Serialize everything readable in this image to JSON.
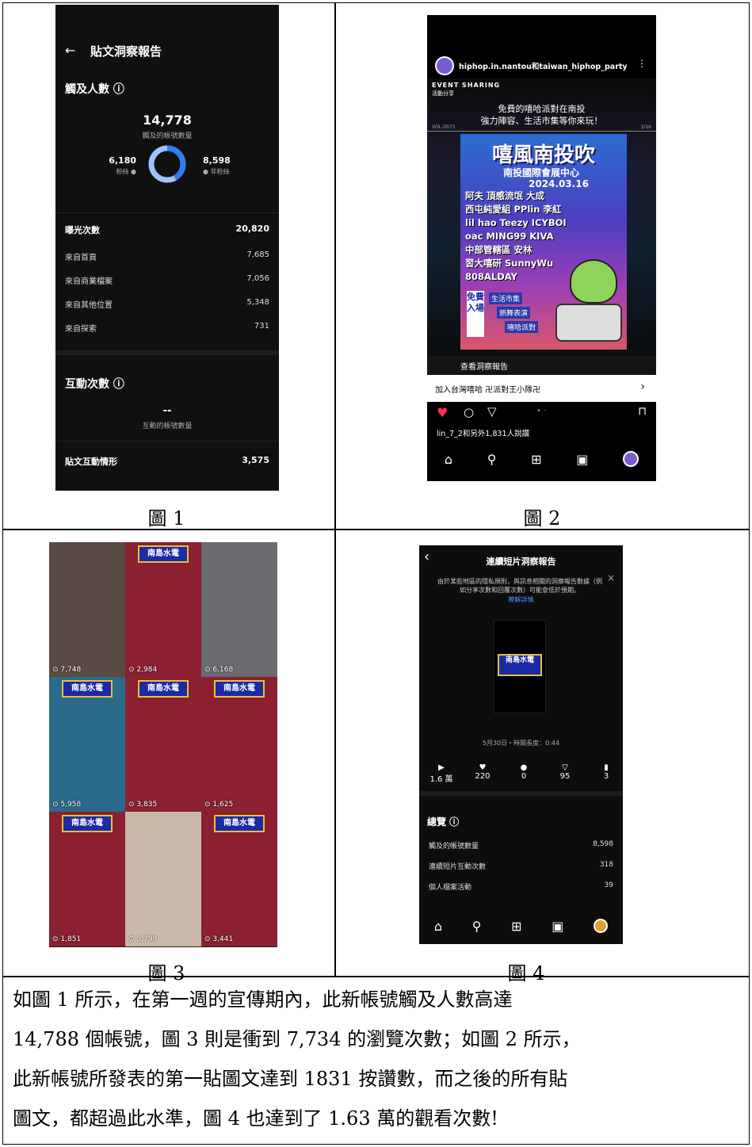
{
  "panel1": {
    "title": "貼文洞察報告",
    "back": "←",
    "reach_heading": "觸及人數 ⓘ",
    "reach_total": "14,778",
    "reach_caption": "觸及的帳號數量",
    "followers_value": "6,180",
    "followers_label": "粉絲 ●",
    "nonfollowers_value": "8,598",
    "nonfollowers_label": "● 非粉絲",
    "followers_fraction": 0.418,
    "impressions_label": "曝光次數",
    "impressions_value": "20,820",
    "rows": [
      {
        "label": "來自首頁",
        "value": "7,685"
      },
      {
        "label": "來自商業檔案",
        "value": "7,056"
      },
      {
        "label": "來自其他位置",
        "value": "5,348"
      },
      {
        "label": "來自探索",
        "value": "731"
      }
    ],
    "interactions_heading": "互動次數 ⓘ",
    "interactions_value": "--",
    "interactions_caption": "互動的帳號數量",
    "post_interactions_label": "貼文互動情形",
    "post_interactions_value": "3,575"
  },
  "panel2": {
    "account": "hiphop.in.nantou和taiwan_hiphop_party",
    "menu": "⋮",
    "event_sharing": "EVENT SHARING",
    "event_sub": "活動分享",
    "tagline1": "免費的嘻哈派對在南投",
    "tagline2": "強力陣容、生活市集等你來玩！",
    "vol": "VOL.0073",
    "page": "3/16",
    "poster_title": "嘻風南投吹",
    "venue": "南投國際會展中心",
    "date": "2024.03.16",
    "lineup": [
      "阿夫 頂感流氓 大成",
      "西屯純愛組 PPlin 李紅",
      "lil hao Teezy ICYBOI",
      "oac MING99 KIVA",
      "中部管轄區 安林",
      "習大嘻研 SunnyWu",
      "808ALDAY"
    ],
    "free_entry": "免費入場",
    "tags": [
      "生活市集",
      "熱舞表演",
      "嘻哈派對"
    ],
    "insights_link": "查看洞察報告",
    "join_text": "加入台灣嘻哈 卍派對王小隊卍",
    "join_arrow": "›",
    "likes_text": "lin_7_2和另外1,831人說讚"
  },
  "panel3": {
    "brand": "南島水電",
    "tiles": [
      "7,748",
      "2,984",
      "6,168",
      "5,958",
      "3,835",
      "1,625",
      "1,851",
      "5,799",
      "3,441"
    ]
  },
  "panel4": {
    "title": "連續短片洞察報告",
    "back": "‹",
    "close": "×",
    "notice": "由於某些地區的隱私規則，與訊息相關的洞察報告數據（例如分享次數和回覆次數）可能會低於預期。",
    "learn_more": "瞭解詳情",
    "brand": "南島水電",
    "meta": "5月30日・時間長度：0:44",
    "stats": [
      {
        "icon": "▶",
        "value": "1.6 萬"
      },
      {
        "icon": "♥",
        "value": "220"
      },
      {
        "icon": "●",
        "value": "0"
      },
      {
        "icon": "▽",
        "value": "95"
      },
      {
        "icon": "▮",
        "value": "3"
      }
    ],
    "overview_heading": "總覽 ⓘ",
    "overview_rows": [
      {
        "label": "觸及的帳號數量",
        "value": "8,598"
      },
      {
        "label": "連續短片互動次數",
        "value": "318"
      },
      {
        "label": "個人檔案活動",
        "value": "39"
      }
    ]
  },
  "captions": [
    "圖 1",
    "圖 2",
    "圖 3",
    "圖 4"
  ],
  "paragraph": [
    "如圖 1 所示，在第一週的宣傳期內，此新帳號觸及人數高達",
    "14,788 個帳號，圖 3 則是衝到 7,734 的瀏覽次數；如圖 2 所示，",
    "此新帳號所發表的第一貼圖文達到 1831 按讚數，而之後的所有貼",
    "圖文，都超過此水準，圖 4 也達到了 1.63 萬的觀看次數!"
  ],
  "colors": {
    "followers": "#2f7df6",
    "nonfollowers": "#9ec3ff",
    "link": "#4a90ff",
    "heart": "#ff2d55"
  }
}
